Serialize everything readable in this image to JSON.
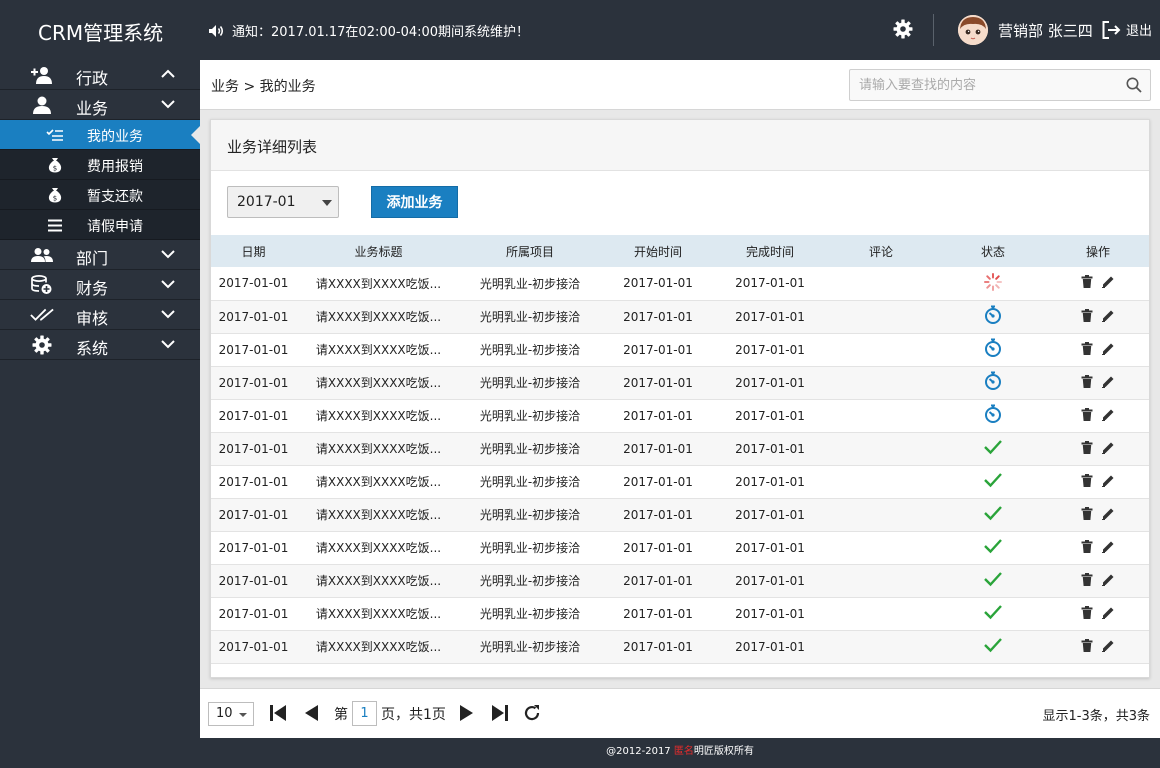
{
  "header": {
    "app_title": "CRM管理系统",
    "notice": "通知：2017.01.17在02:00-04:00期间系统维护！",
    "user": "营销部 张三四",
    "logout_label": "退出"
  },
  "sidebar": {
    "items": [
      {
        "label": "行政",
        "icon": "add-user-icon"
      },
      {
        "label": "业务",
        "icon": "user-icon"
      },
      {
        "label": "部门",
        "icon": "group-icon"
      },
      {
        "label": "财务",
        "icon": "coins-icon"
      },
      {
        "label": "审核",
        "icon": "double-check-icon"
      },
      {
        "label": "系统",
        "icon": "gear-icon"
      }
    ],
    "sub_items": [
      {
        "label": "我的业务",
        "icon": "list-check-icon"
      },
      {
        "label": "费用报销",
        "icon": "money-bag-icon"
      },
      {
        "label": "暂支还款",
        "icon": "money-bag-icon"
      },
      {
        "label": "请假申请",
        "icon": "menu-lines-icon"
      }
    ]
  },
  "topbar": {
    "breadcrumb": "业务 > 我的业务",
    "search_placeholder": "请输入要查找的内容"
  },
  "panel": {
    "title": "业务详细列表",
    "month": "2017-01",
    "add_button": "添加业务"
  },
  "table": {
    "columns": [
      "日期",
      "业务标题",
      "所属项目",
      "开始时间",
      "完成时间",
      "评论",
      "状态",
      "操作"
    ],
    "rows": [
      {
        "date": "2017-01-01",
        "title": "请XXXX到XXXX吃饭...",
        "project": "光明乳业-初步接洽",
        "start": "2017-01-01",
        "end": "2017-01-01",
        "comment": "",
        "status": "loading"
      },
      {
        "date": "2017-01-01",
        "title": "请XXXX到XXXX吃饭...",
        "project": "光明乳业-初步接洽",
        "start": "2017-01-01",
        "end": "2017-01-01",
        "comment": "",
        "status": "timer"
      },
      {
        "date": "2017-01-01",
        "title": "请XXXX到XXXX吃饭...",
        "project": "光明乳业-初步接洽",
        "start": "2017-01-01",
        "end": "2017-01-01",
        "comment": "",
        "status": "timer"
      },
      {
        "date": "2017-01-01",
        "title": "请XXXX到XXXX吃饭...",
        "project": "光明乳业-初步接洽",
        "start": "2017-01-01",
        "end": "2017-01-01",
        "comment": "",
        "status": "timer"
      },
      {
        "date": "2017-01-01",
        "title": "请XXXX到XXXX吃饭...",
        "project": "光明乳业-初步接洽",
        "start": "2017-01-01",
        "end": "2017-01-01",
        "comment": "",
        "status": "timer"
      },
      {
        "date": "2017-01-01",
        "title": "请XXXX到XXXX吃饭...",
        "project": "光明乳业-初步接洽",
        "start": "2017-01-01",
        "end": "2017-01-01",
        "comment": "",
        "status": "done"
      },
      {
        "date": "2017-01-01",
        "title": "请XXXX到XXXX吃饭...",
        "project": "光明乳业-初步接洽",
        "start": "2017-01-01",
        "end": "2017-01-01",
        "comment": "",
        "status": "done"
      },
      {
        "date": "2017-01-01",
        "title": "请XXXX到XXXX吃饭...",
        "project": "光明乳业-初步接洽",
        "start": "2017-01-01",
        "end": "2017-01-01",
        "comment": "",
        "status": "done"
      },
      {
        "date": "2017-01-01",
        "title": "请XXXX到XXXX吃饭...",
        "project": "光明乳业-初步接洽",
        "start": "2017-01-01",
        "end": "2017-01-01",
        "comment": "",
        "status": "done"
      },
      {
        "date": "2017-01-01",
        "title": "请XXXX到XXXX吃饭...",
        "project": "光明乳业-初步接洽",
        "start": "2017-01-01",
        "end": "2017-01-01",
        "comment": "",
        "status": "done"
      },
      {
        "date": "2017-01-01",
        "title": "请XXXX到XXXX吃饭...",
        "project": "光明乳业-初步接洽",
        "start": "2017-01-01",
        "end": "2017-01-01",
        "comment": "",
        "status": "done"
      },
      {
        "date": "2017-01-01",
        "title": "请XXXX到XXXX吃饭...",
        "project": "光明乳业-初步接洽",
        "start": "2017-01-01",
        "end": "2017-01-01",
        "comment": "",
        "status": "done"
      }
    ]
  },
  "pager": {
    "page_size": "10",
    "page_prefix": "第",
    "current_page": "1",
    "page_suffix": "页，共1页",
    "summary": "显示1-3条，共3条"
  },
  "footer": {
    "prefix": "@2012-2017 ",
    "highlight": "匿名",
    "suffix": "明匠版权所有"
  },
  "colors": {
    "accent": "#1a7fc1",
    "done": "#2aa43a",
    "loading": "#e04040",
    "header_bg": "#2b323c"
  }
}
